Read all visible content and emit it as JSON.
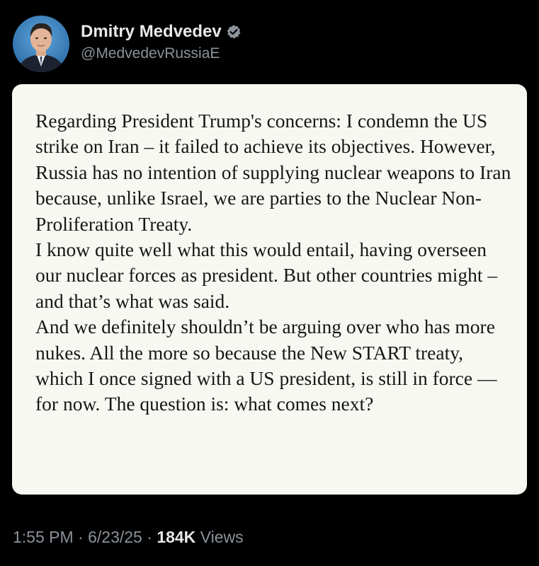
{
  "author": {
    "display_name": "Dmitry Medvedev",
    "handle": "@MedvedevRussiaE",
    "verified_icon": "verified-badge-icon",
    "avatar": "profile-photo"
  },
  "post": {
    "image_text": [
      "Regarding President Trump's concerns: I condemn the US strike on Iran – it failed to achieve its objectives. However, Russia has no intention of supplying nuclear weapons to Iran because, unlike Israel, we are parties to the Nuclear Non-Proliferation Treaty.",
      "I know quite well what this would entail, having overseen our nuclear forces as president. But other countries might – and that’s what was said.",
      "And we definitely shouldn’t be arguing over who has more nukes. All the more so because the New START treaty, which I once signed with a US president, is still in force — for now. The question is: what comes next?"
    ]
  },
  "meta": {
    "time": "1:55 PM",
    "separator": " · ",
    "date": "6/23/25",
    "views_count": "184K",
    "views_label": " Views"
  },
  "colors": {
    "background": "#000000",
    "card_background": "#f8f8f3",
    "primary_text": "#e7e9ea",
    "secondary_text": "#8b9299",
    "verified_badge": "#8b9299"
  }
}
